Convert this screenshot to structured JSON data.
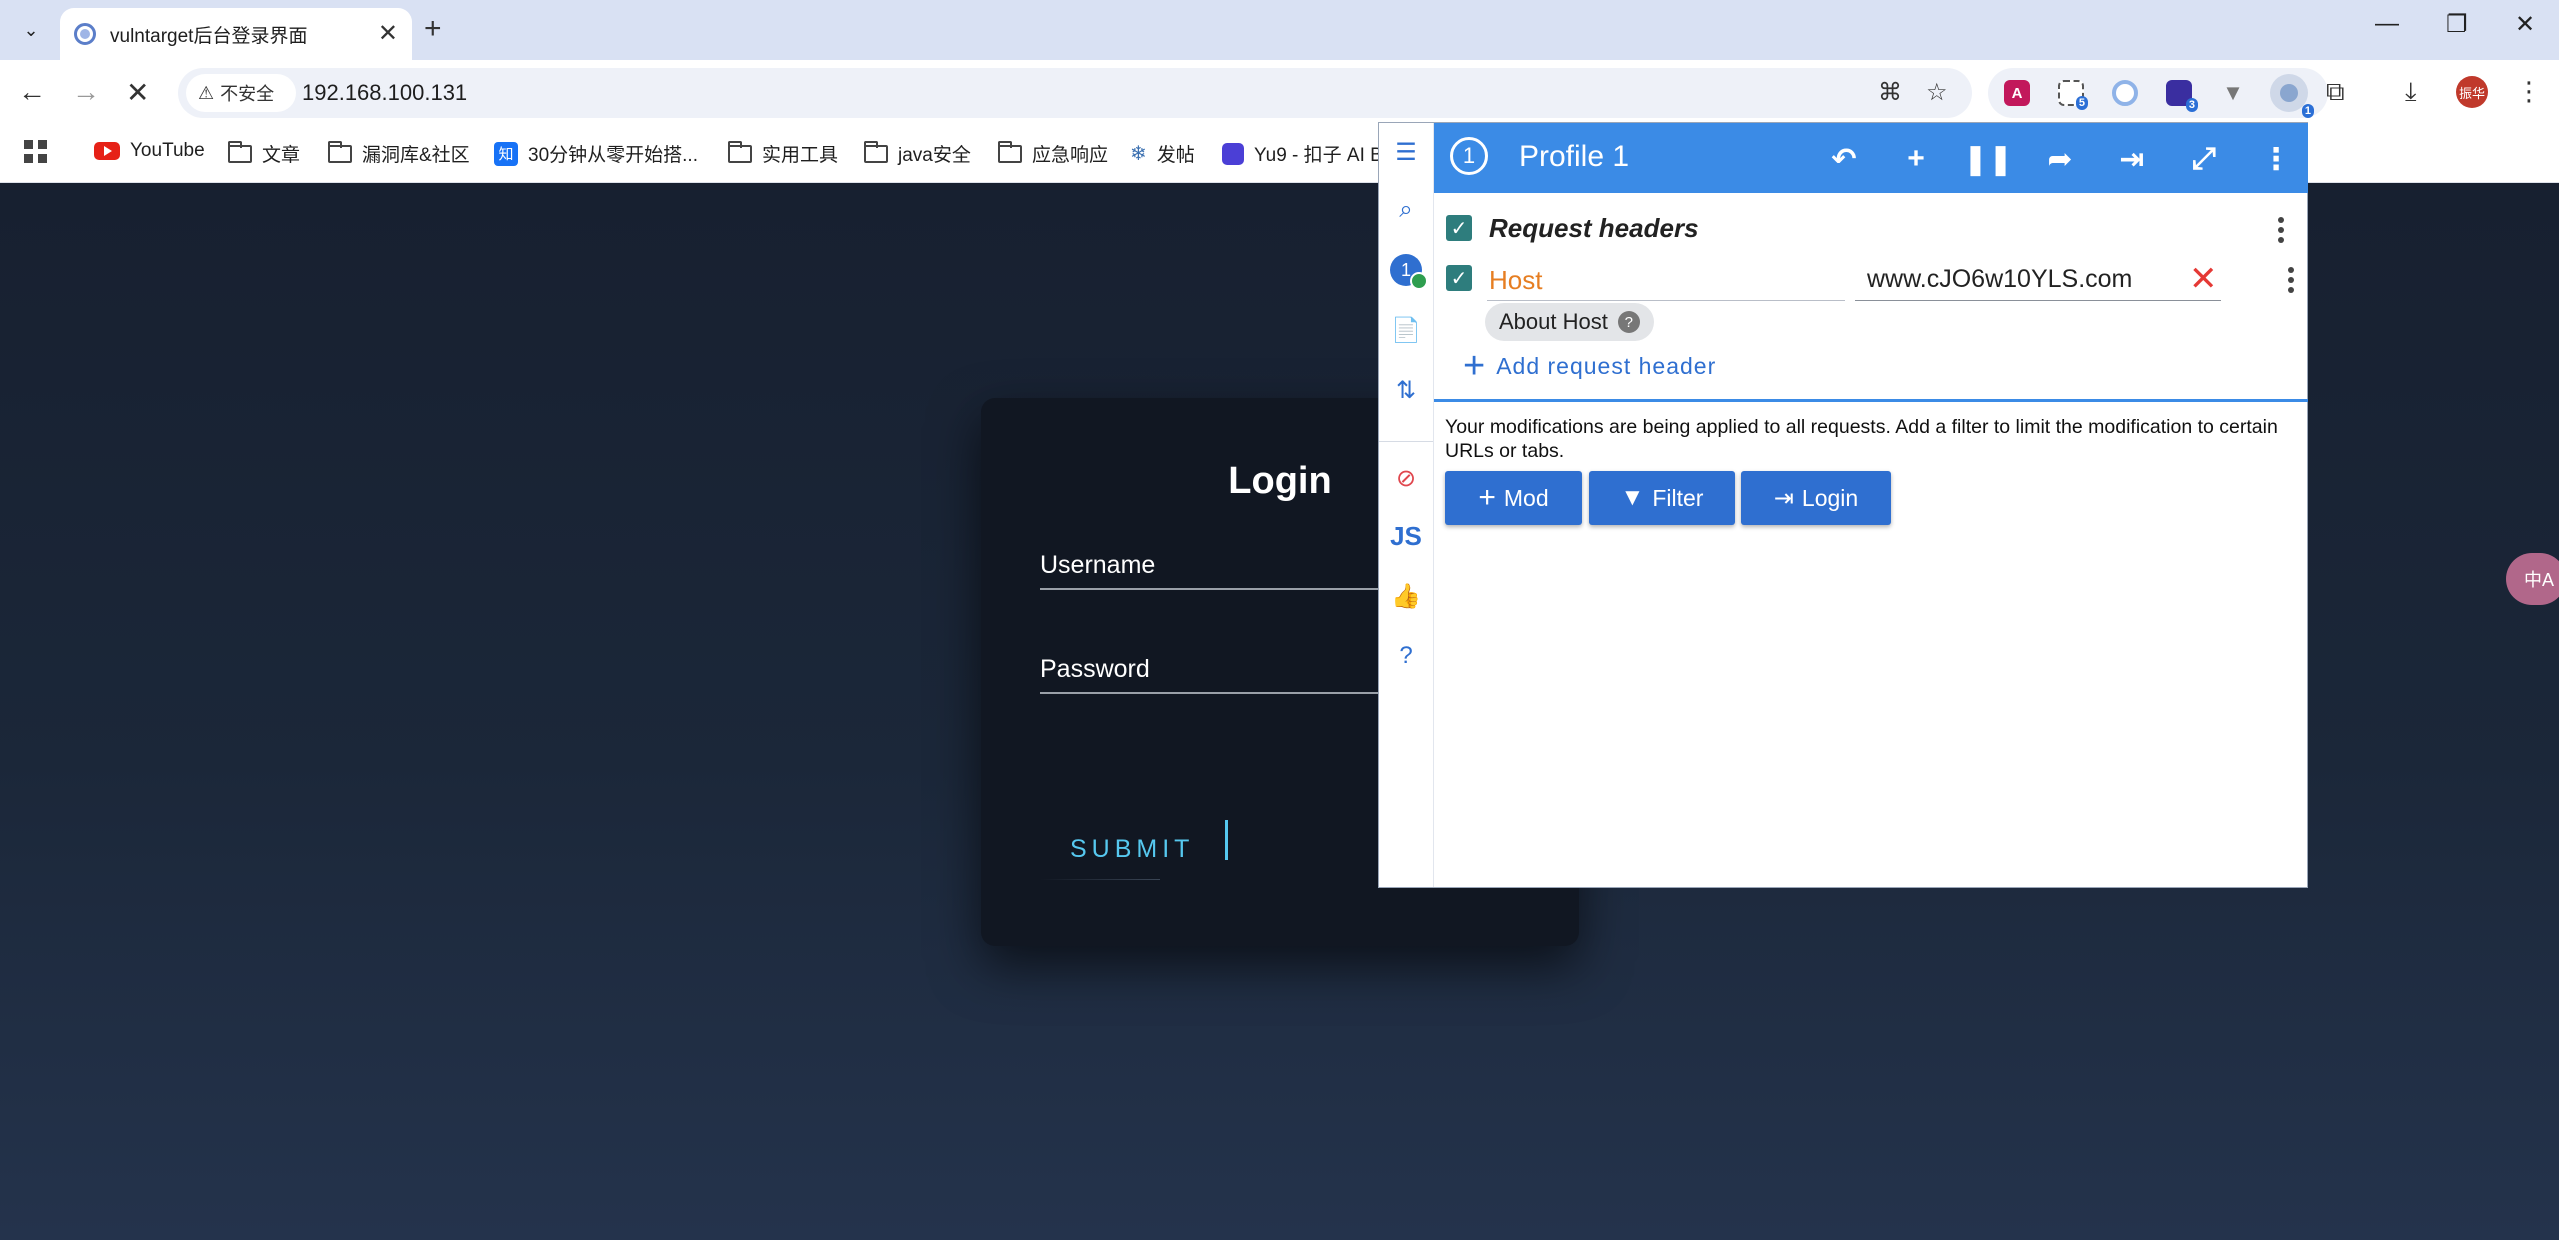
{
  "browser": {
    "tab_title": "vulntarget后台登录界面",
    "url": "192.168.100.131",
    "security_label": "不安全",
    "extensions": [
      {
        "name": "translate-ext-icon",
        "badge": ""
      },
      {
        "name": "screenshot-ext-icon",
        "badge": "5"
      },
      {
        "name": "circle-ext-icon",
        "badge": ""
      },
      {
        "name": "cube-ext-icon",
        "badge": "3"
      },
      {
        "name": "vue-ext-icon",
        "badge": ""
      },
      {
        "name": "modheader-ext-icon",
        "badge": "1"
      }
    ],
    "avatar_text": "振华",
    "bookmarks": [
      {
        "label": "YouTube"
      },
      {
        "label": "文章"
      },
      {
        "label": "漏洞库&社区"
      },
      {
        "label": "30分钟从零开始搭..."
      },
      {
        "label": "实用工具"
      },
      {
        "label": "java安全"
      },
      {
        "label": "应急响应"
      },
      {
        "label": "发帖"
      },
      {
        "label": "Yu9 - 扣子 AI B"
      }
    ]
  },
  "page": {
    "login_title": "Login",
    "username_label": "Username",
    "password_label": "Password",
    "submit_label": "SUBMIT",
    "translate_float": "中A"
  },
  "modheader": {
    "profile_number": "1",
    "profile_name": "Profile 1",
    "section_title": "Request headers",
    "header_name": "Host",
    "header_value": "www.cJO6w10YLS.com",
    "about_chip": "About Host",
    "add_header_label": "Add request header",
    "notice": "Your modifications are being applied to all requests. Add a filter to limit the modification to certain URLs or tabs.",
    "buttons": {
      "mod": "Mod",
      "filter": "Filter",
      "login": "Login"
    },
    "sidebar_js": "JS"
  },
  "colors": {
    "accent": "#3b8be6",
    "button_blue": "#2f6fd0",
    "header_name_orange": "#e67e22",
    "submit_cyan": "#56c8ef"
  }
}
